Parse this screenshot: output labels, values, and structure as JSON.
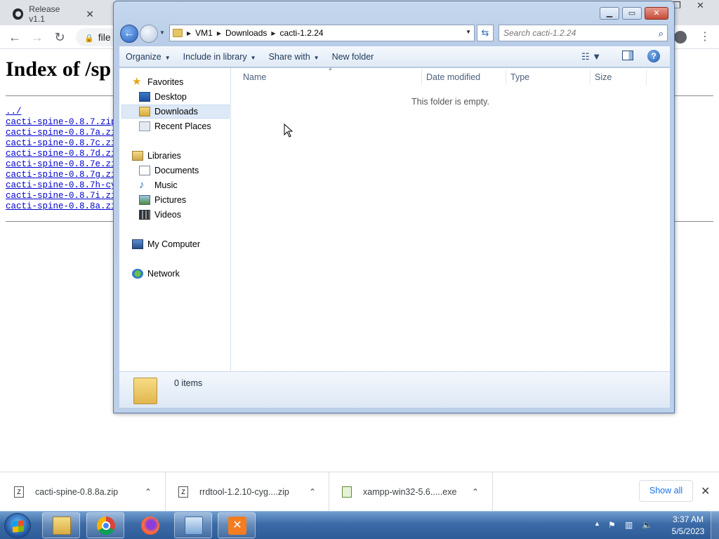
{
  "browser": {
    "tabs": [
      {
        "label": "Release v1.1",
        "close": "✕"
      },
      {
        "label": ""
      }
    ],
    "window_controls": {
      "restore": "❐",
      "close": "✕"
    },
    "address_text": "file",
    "page": {
      "heading": "Index of /sp",
      "links": [
        "../",
        "cacti-spine-0.8.7.zip",
        "cacti-spine-0.8.7a.zip",
        "cacti-spine-0.8.7c.zip",
        "cacti-spine-0.8.7d.zip",
        "cacti-spine-0.8.7e.zip",
        "cacti-spine-0.8.7g.zip",
        "cacti-spine-0.8.7h-cyg",
        "cacti-spine-0.8.7i.zip",
        "cacti-spine-0.8.8a.zip"
      ]
    },
    "downloads": [
      {
        "name": "cacti-spine-0.8.8a.zip"
      },
      {
        "name": "rrdtool-1.2.10-cyg....zip"
      },
      {
        "name": "xampp-win32-5.6.....exe"
      }
    ],
    "show_all": "Show all"
  },
  "explorer": {
    "breadcrumb": [
      "VM1",
      "Downloads",
      "cacti-1.2.24"
    ],
    "search_placeholder": "Search cacti-1.2.24",
    "toolbar": {
      "organize": "Organize",
      "include_in_library": "Include in library",
      "share_with": "Share with",
      "new_folder": "New folder"
    },
    "nav": {
      "favorites": "Favorites",
      "desktop": "Desktop",
      "downloads": "Downloads",
      "recent_places": "Recent Places",
      "libraries": "Libraries",
      "documents": "Documents",
      "music": "Music",
      "pictures": "Pictures",
      "videos": "Videos",
      "my_computer": "My Computer",
      "network": "Network"
    },
    "columns": [
      "Name",
      "Date modified",
      "Type",
      "Size"
    ],
    "empty_message": "This folder is empty.",
    "items_count": "0 items"
  },
  "taskbar": {
    "time": "3:37 AM",
    "date": "5/5/2023"
  },
  "colors": {
    "link": "#0000cc",
    "accent": "#1a73e8",
    "taskbar": "#2d5c98"
  }
}
